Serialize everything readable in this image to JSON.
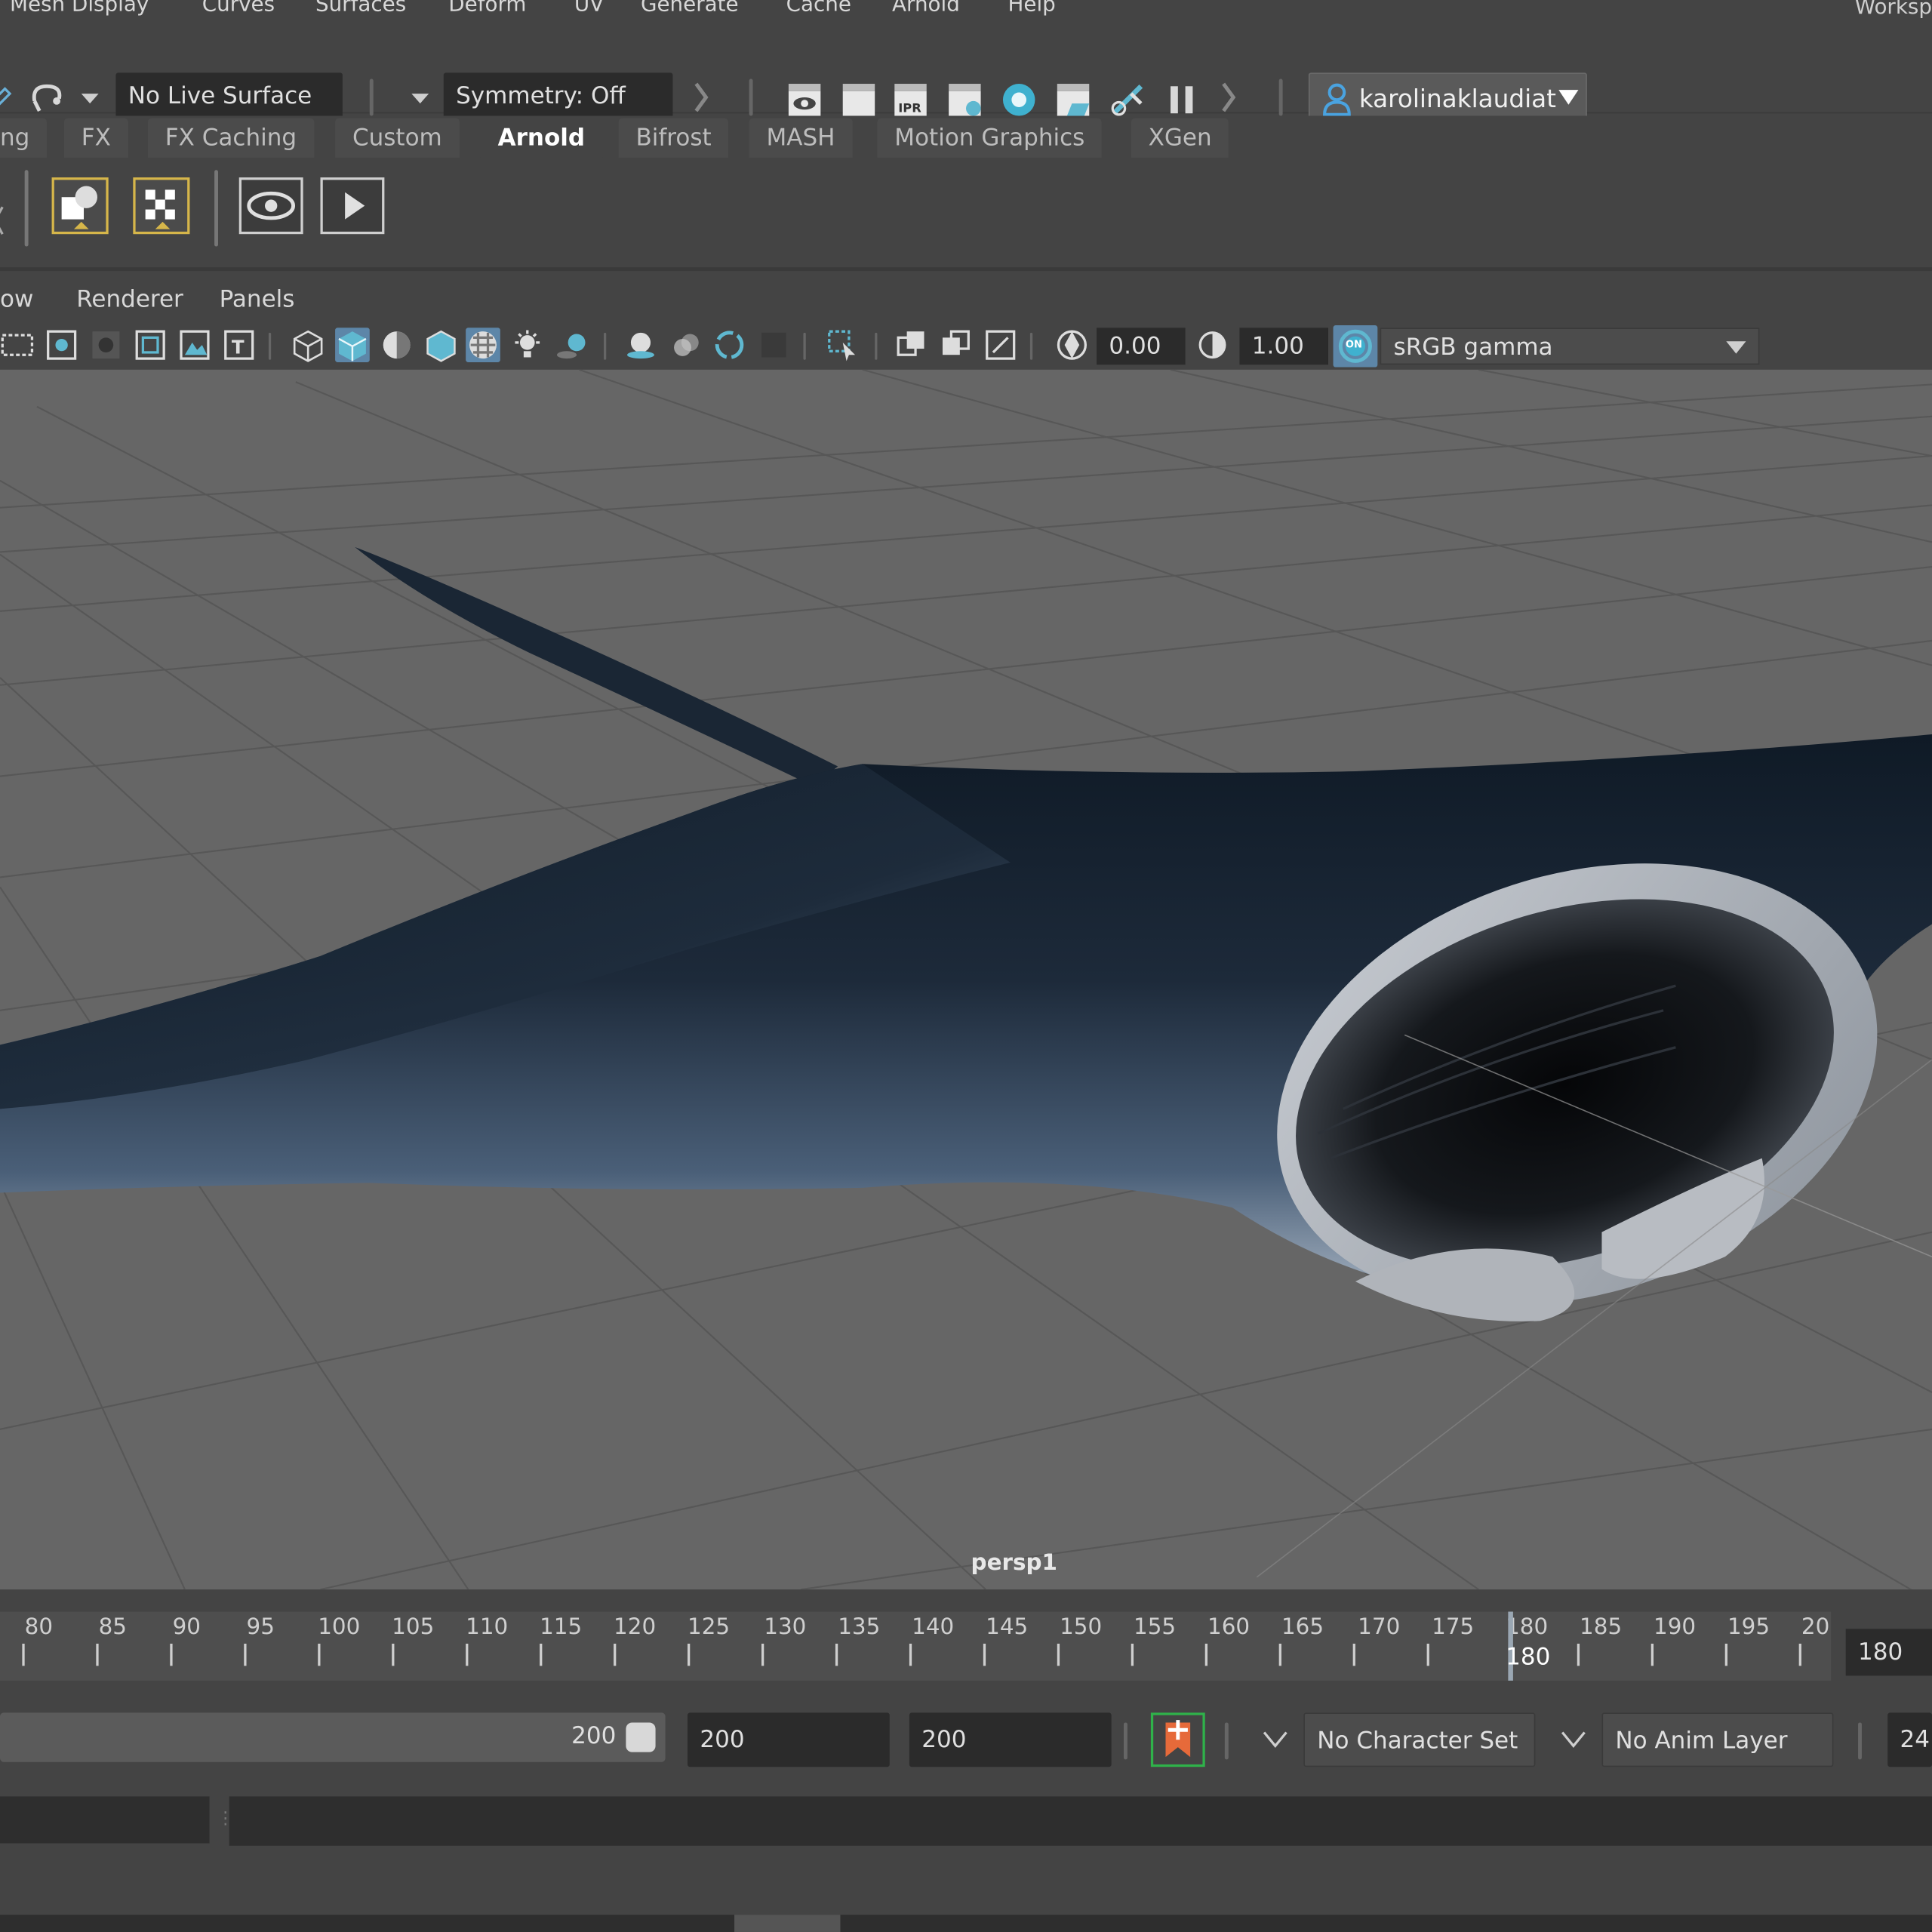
{
  "menubar": {
    "items": [
      "Mesh Display",
      "Curves",
      "Surfaces",
      "Deform",
      "UV",
      "Generate",
      "Cache",
      "Arnold",
      "Help"
    ],
    "workspace": "Worksp"
  },
  "statusline": {
    "live_surface": "No Live Surface",
    "symmetry": "Symmetry: Off",
    "user": "karolinaklaudiat"
  },
  "shelf_tabs": [
    "ng",
    "FX",
    "FX Caching",
    "Custom",
    "Arnold",
    "Bifrost",
    "MASH",
    "Motion Graphics",
    "XGen"
  ],
  "active_tab": "Arnold",
  "panel_menu": [
    "ow",
    "Renderer",
    "Panels"
  ],
  "panel_toolbar": {
    "exposure": "0.00",
    "gamma": "1.00",
    "color_space": "sRGB gamma",
    "color_mgmt_icon": "ON"
  },
  "viewport": {
    "camera": "persp1"
  },
  "timeslider": {
    "ticks": [
      "80",
      "85",
      "90",
      "95",
      "100",
      "105",
      "110",
      "115",
      "120",
      "125",
      "130",
      "135",
      "140",
      "145",
      "150",
      "155",
      "160",
      "165",
      "170",
      "175",
      "180",
      "185",
      "190",
      "195",
      "20"
    ],
    "current_frame_label": "180",
    "current_frame_field": "180"
  },
  "range": {
    "slider_end": "200",
    "end_time": "200",
    "playback_end": "200",
    "character_set": "No Character Set",
    "anim_layer": "No Anim Layer",
    "fps": "24"
  }
}
